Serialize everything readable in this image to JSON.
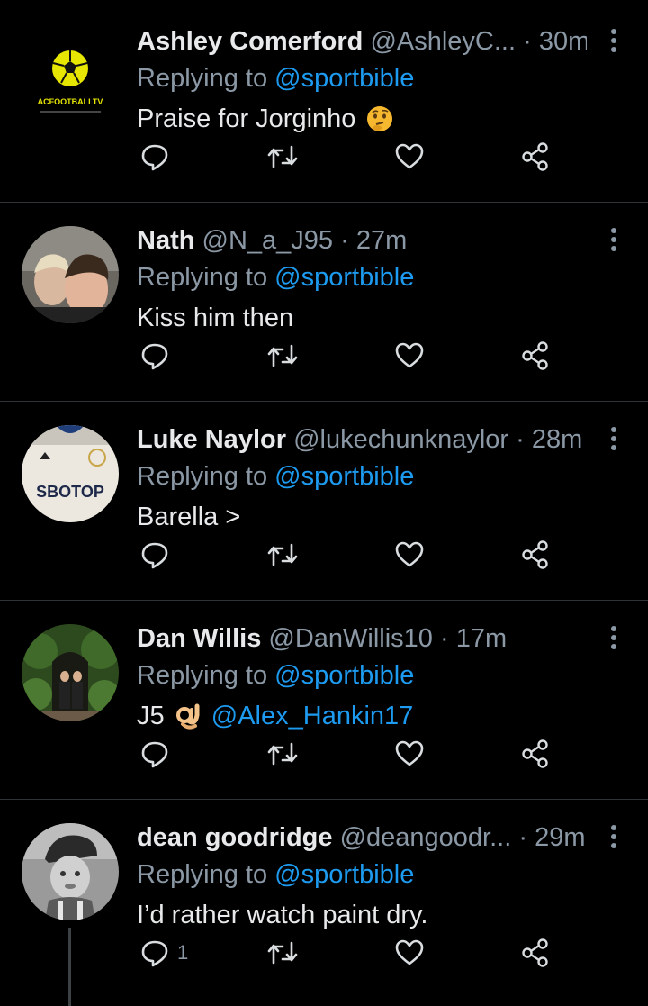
{
  "replying_label": "Replying to",
  "colors": {
    "background": "#000000",
    "link": "#1d9bf0",
    "muted": "#8b98a5",
    "text": "#e7e9ea",
    "divider": "#2f3336"
  },
  "tweets": [
    {
      "name": "Ashley Comerford",
      "handle": "@AshleyC...",
      "sep": "·",
      "time": "30m",
      "reply_to": "@sportbible",
      "text": "Praise for Jorginho",
      "emoji": "thinking-face",
      "avatar_text": "ACFOOTBALLTV",
      "reply_count": ""
    },
    {
      "name": "Nath",
      "handle": "@N_a_J95",
      "sep": "·",
      "time": "27m",
      "reply_to": "@sportbible",
      "text": "Kiss him then",
      "reply_count": ""
    },
    {
      "name": "Luke Naylor",
      "handle": "@lukechunknaylor",
      "sep": "·",
      "time": "28m",
      "reply_to": "@sportbible",
      "text": "Barella >",
      "avatar_text": "SBOTOP",
      "reply_count": ""
    },
    {
      "name": "Dan Willis",
      "handle": "@DanWillis10",
      "sep": "·",
      "time": "17m",
      "reply_to": "@sportbible",
      "text": "J5",
      "emoji": "ok-hand",
      "mention": "@Alex_Hankin17",
      "reply_count": ""
    },
    {
      "name": "dean goodridge",
      "handle": "@deangoodr...",
      "sep": "·",
      "time": "29m",
      "reply_to": "@sportbible",
      "text": "I’d rather watch paint dry.",
      "reply_count": "1"
    }
  ]
}
